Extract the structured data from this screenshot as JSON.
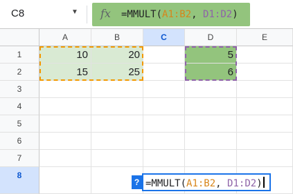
{
  "name_box": {
    "ref": "C8",
    "dropdown_icon": "chevron-down-icon"
  },
  "formula_bar": {
    "fx_label": "fx",
    "func": "=MMULT(",
    "range1": "A1:B2",
    "sep": ", ",
    "range2": "D1:D2",
    "close": ")"
  },
  "columns": [
    "A",
    "B",
    "C",
    "D",
    "E"
  ],
  "selected_column": "C",
  "rows": [
    "1",
    "2",
    "3",
    "4",
    "5",
    "6",
    "7",
    "8"
  ],
  "selected_row": "8",
  "cells": {
    "A1": "10",
    "B1": "20",
    "D1": "5",
    "A2": "15",
    "B2": "25",
    "D2": "6"
  },
  "editor": {
    "hint_icon": "?",
    "func": "=MMULT(",
    "range1": "A1:B2",
    "sep": ", ",
    "range2": "D1:D2",
    "close": ")"
  },
  "colors": {
    "range_a_fill": "#d9ead3",
    "range_a_border": "#f29900",
    "range_d_fill": "#93c47d",
    "range_d_border": "#8e63a8",
    "selection_blue": "#1a73e8"
  }
}
